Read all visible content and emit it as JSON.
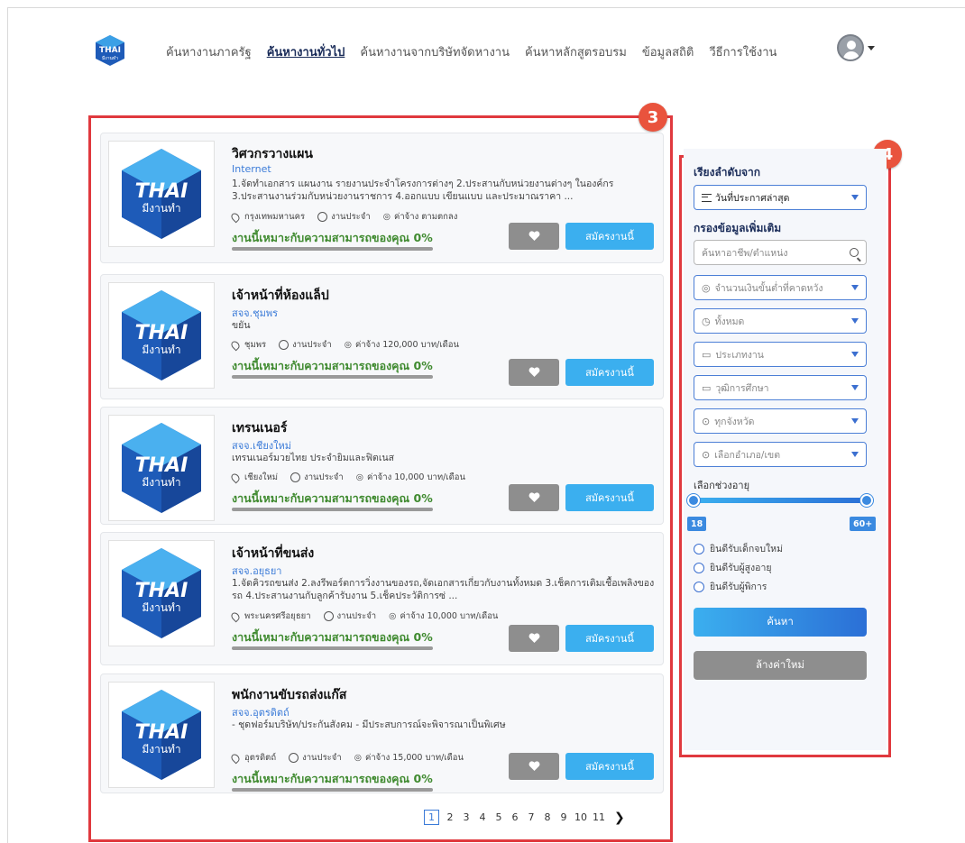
{
  "header": {
    "logo_text_top": "THAI",
    "logo_text_bottom": "มีงานทำ",
    "nav": [
      {
        "label": "ค้นหางานภาครัฐ",
        "active": false
      },
      {
        "label": "ค้นหางานทั่วไป",
        "active": true
      },
      {
        "label": "ค้นหางานจากบริษัทจัดหางาน",
        "active": false
      },
      {
        "label": "ค้นหาหลักสูตรอบรม",
        "active": false
      },
      {
        "label": "ข้อมูลสถิติ",
        "active": false
      },
      {
        "label": "วีธีการใช้งาน",
        "active": false
      }
    ]
  },
  "annotations": {
    "results_badge": "3",
    "filter_badge": "4"
  },
  "jobs": [
    {
      "title": "วิศวกรวางแผน",
      "company": "Internet",
      "desc": "1.จัดทำเอกสาร แผนงาน รายงานประจำโครงการต่างๆ 2.ประสานกับหน่วยงานต่างๆ ในองค์กร 3.ประสานงานร่วมกับหน่วยงานราชการ 4.ออกแบบ เขียนแบบ และประมาณราคา ...",
      "location": "กรุงเทพมหานคร",
      "job_type": "งานประจำ",
      "wage": "ค่าจ้าง ตามตกลง",
      "match": "งานนี้เหมาะกับความสามารถของคุณ 0%",
      "apply": "สมัครงานนี้"
    },
    {
      "title": "เจ้าหน้าที่ห้องแล็ป",
      "company": "สจจ.ชุมพร",
      "desc": "ขยัน",
      "location": "ชุมพร",
      "job_type": "งานประจำ",
      "wage": "ค่าจ้าง 120,000 บาท/เดือน",
      "match": "งานนี้เหมาะกับความสามารถของคุณ 0%",
      "apply": "สมัครงานนี้"
    },
    {
      "title": "เทรนเนอร์",
      "company": "สจจ.เชียงใหม่",
      "desc": "เทรนเนอร์มวยไทย ประจำยิมและฟิตเนส",
      "location": "เชียงใหม่",
      "job_type": "งานประจำ",
      "wage": "ค่าจ้าง 10,000 บาท/เดือน",
      "match": "งานนี้เหมาะกับความสามารถของคุณ 0%",
      "apply": "สมัครงานนี้"
    },
    {
      "title": "เจ้าหน้าที่ขนส่ง",
      "company": "สจจ.อยุธยา",
      "desc": "1.จัดคิวรถขนส่ง 2.ลงรีพอร์ตการวิ่งงานของรถ,จัดเอกสารเกี่ยวกับงานทั้งหมด 3.เช็คการเติมเชื้อเพลิงของรถ 4.ประสานงานกับลูกค้ารับงาน 5.เช็คประวัติการซ่ ...",
      "location": "พระนครศรีอยุธยา",
      "job_type": "งานประจำ",
      "wage": "ค่าจ้าง 10,000 บาท/เดือน",
      "match": "งานนี้เหมาะกับความสามารถของคุณ 0%",
      "apply": "สมัครงานนี้"
    },
    {
      "title": "พนักงานขับรถส่งแก๊ส",
      "company": "สจจ.อุตรดิตถ์",
      "desc": "- ชุดฟอร์มบริษัท/ประกันสังคม - มีประสบการณ์จะพิจารณาเป็นพิเศษ",
      "location": "อุตรดิตถ์",
      "job_type": "งานประจำ",
      "wage": "ค่าจ้าง 15,000 บาท/เดือน",
      "match": "งานนี้เหมาะกับความสามารถของคุณ 0%",
      "apply": "สมัครงานนี้"
    }
  ],
  "pagination": {
    "pages": [
      "1",
      "2",
      "3",
      "4",
      "5",
      "6",
      "7",
      "8",
      "9",
      "10",
      "11"
    ],
    "current": "1",
    "next": "❯"
  },
  "sidebar": {
    "sort_heading": "เรียงลำดับจาก",
    "sort_value": "วันที่ประกาศล่าสุด",
    "filter_heading": "กรองข้อมูลเพิ่มเติม",
    "search_placeholder": "ค้นหาอาชีพ/ตำแหน่ง",
    "salary": "จำนวนเงินขั้นต่ำที่คาดหวัง",
    "time": "ทั้งหมด",
    "job_type": "ประเภทงาน",
    "education": "วุฒิการศึกษา",
    "province": "ทุกจังหวัด",
    "district": "เลือกอำเภอ/เขต",
    "age_label": "เลือกช่วงอายุ",
    "age_min": "18",
    "age_max": "60+",
    "radios": [
      "ยินดีรับเด็กจบใหม่",
      "ยินดีรับผู้สูงอายุ",
      "ยินดีรับผู้พิการ"
    ],
    "search_btn": "ค้นหา",
    "reset_btn": "ล้างค่าใหม่"
  },
  "colors": {
    "accent": "#3bafef",
    "highlight": "#e0393e",
    "match_green": "#3f8a2f"
  }
}
